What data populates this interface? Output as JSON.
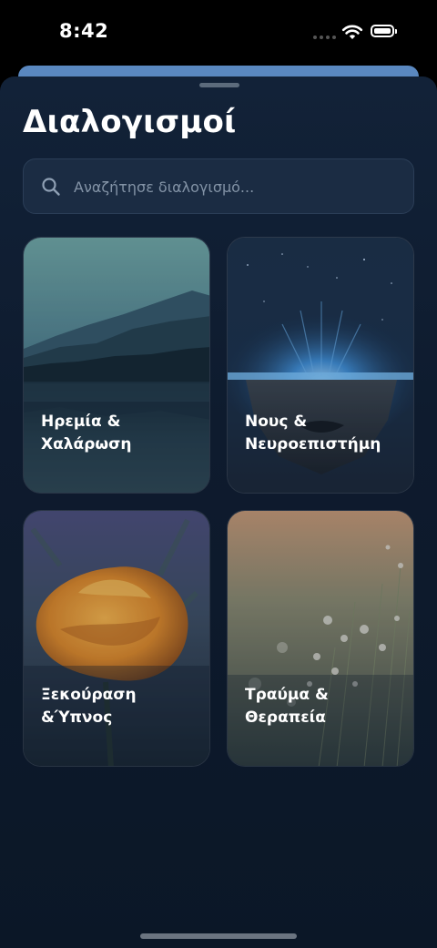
{
  "status_bar": {
    "time": "8:42"
  },
  "screen": {
    "title": "Διαλογισμοί",
    "search": {
      "placeholder": "Αναζήτησε διαλογισμό..."
    },
    "categories": [
      {
        "label": "Ηρεμία &\nΧαλάρωση",
        "image": "mountain-lake"
      },
      {
        "label": "Νους &\nΝευροεπιστήμη",
        "image": "glowing-face"
      },
      {
        "label": "Ξεκούραση\n&Ύπνος",
        "image": "orange-flower"
      },
      {
        "label": "Τραύμα &\nΘεραπεία",
        "image": "wildflowers"
      }
    ]
  },
  "colors": {
    "sheet_background": "#0e1b2e",
    "peek_card": "#5a88c0",
    "search_field": "#1b2c43"
  }
}
